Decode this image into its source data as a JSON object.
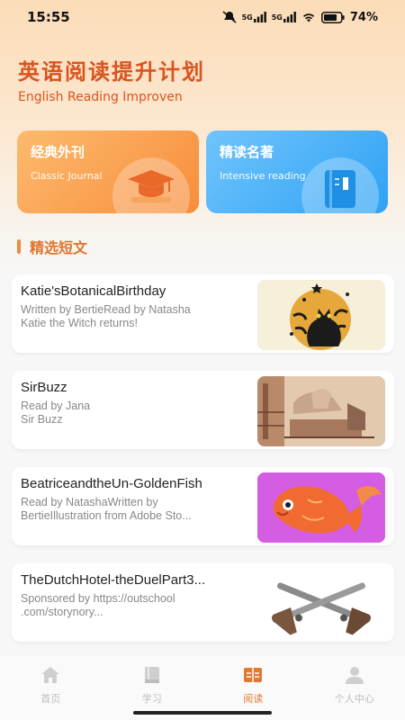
{
  "status": {
    "time": "15:55",
    "network1": "5G",
    "network2": "5G",
    "battery": "74%"
  },
  "header": {
    "title_zh": "英语阅读提升计划",
    "title_en": "English Reading Improven"
  },
  "cards": [
    {
      "title": "经典外刊",
      "subtitle": "Classic Journal",
      "icon": "graduation-cap-icon",
      "color": "#f78d3b"
    },
    {
      "title": "精读名著",
      "subtitle": "Intensive reading",
      "icon": "book-icon",
      "color": "#2fa2f5"
    }
  ],
  "section": {
    "title": "精选短文"
  },
  "articles": [
    {
      "title": "Katie'sBotanicalBirthday",
      "desc_line1": "Written by BertieRead by Natasha",
      "desc_line2": "Katie the Witch returns!",
      "thumb": "black-cat-illustration"
    },
    {
      "title": "SirBuzz",
      "desc_line1": "Read by Jana",
      "desc_line2": "Sir Buzz",
      "thumb": "vintage-engraving"
    },
    {
      "title": "BeatriceandtheUn-GoldenFish",
      "desc_line1": "Read by NatashaWritten by",
      "desc_line2": "BertieIllustration from Adobe Sto...",
      "thumb": "orange-fish-illustration"
    },
    {
      "title": "TheDutchHotel-theDuelPart3...",
      "desc_line1": "Sponsored by https://outschool",
      "desc_line2": ".com/storynory...",
      "thumb": "dueling-pistols-image"
    }
  ],
  "tabs": [
    {
      "label": "首页",
      "icon": "home-icon",
      "active": false
    },
    {
      "label": "学习",
      "icon": "book-icon",
      "active": false
    },
    {
      "label": "阅读",
      "icon": "reading-icon",
      "active": true
    },
    {
      "label": "个人中心",
      "icon": "user-icon",
      "active": false
    }
  ],
  "colors": {
    "accent": "#e0742e",
    "title": "#d9541f",
    "inactive_tab": "#bdbdbd"
  }
}
